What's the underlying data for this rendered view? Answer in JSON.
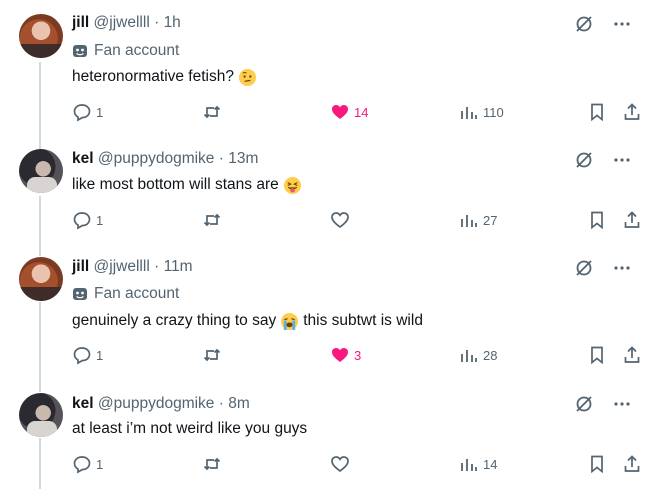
{
  "tweets": [
    {
      "name": "jill",
      "handle": "@jjwellll",
      "time": "1h",
      "label": "Fan account",
      "text": "heteronormative fetish?",
      "emoji": "raised-eyebrow-face",
      "replies": "1",
      "likes": "14",
      "liked": true,
      "views": "110"
    },
    {
      "name": "kel",
      "handle": "@puppydogmike",
      "time": "13m",
      "label": "",
      "text": "like most bottom will stans are",
      "emoji": "tongue-out-face",
      "replies": "1",
      "likes": "",
      "liked": false,
      "views": "27"
    },
    {
      "name": "jill",
      "handle": "@jjwellll",
      "time": "11m",
      "label": "Fan account",
      "text": "genuinely a crazy thing to say",
      "text_after": "this subtwt is wild",
      "emoji": "crying-face",
      "replies": "1",
      "likes": "3",
      "liked": true,
      "views": "28"
    },
    {
      "name": "kel",
      "handle": "@puppydogmike",
      "time": "8m",
      "label": "",
      "text": "at least i’m not weird like you guys",
      "emoji": "",
      "replies": "1",
      "likes": "",
      "liked": false,
      "views": "14"
    }
  ],
  "separator": "·",
  "colors": {
    "like_active": "#f91880",
    "muted": "#536471",
    "text": "#0f1419",
    "thread_line": "#cfd9de"
  }
}
